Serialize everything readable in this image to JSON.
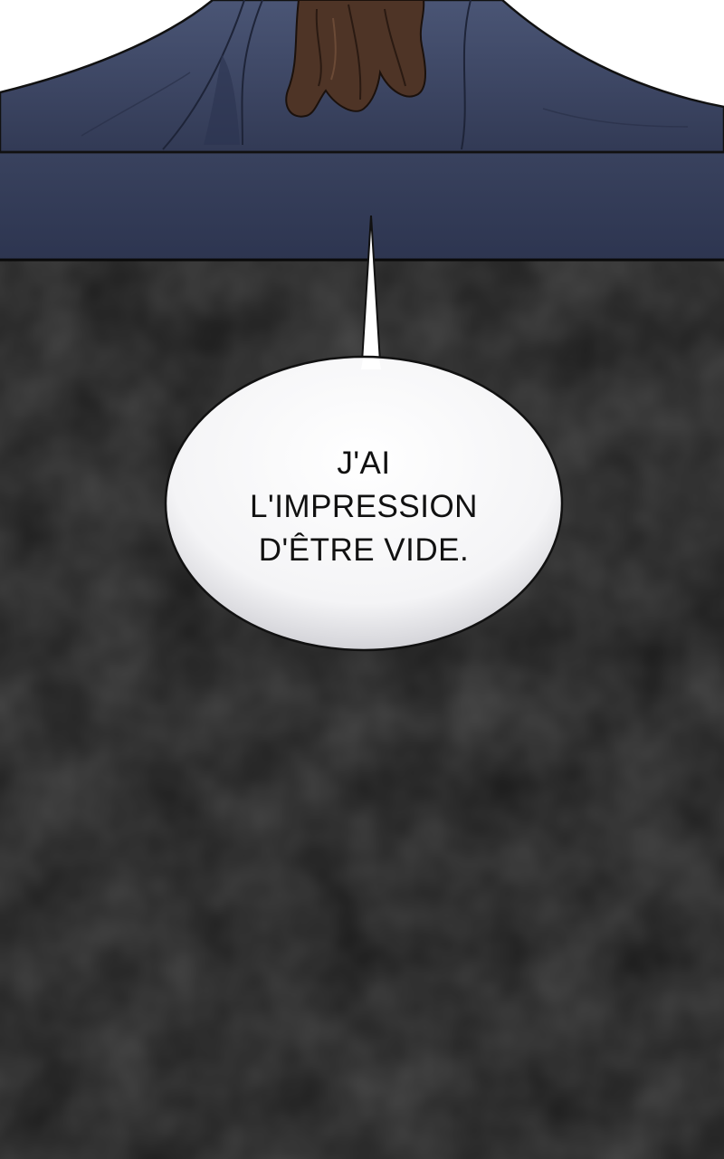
{
  "panel": {
    "speech_lines": [
      "J'AI",
      "L'IMPRESSION",
      "D'ÊTRE VIDE."
    ]
  },
  "colors": {
    "page_background": "#ffffff",
    "shadow_background": "#1a1a1a",
    "cloak_blue": "#3c4663",
    "cloak_shadow": "#2c3450",
    "hair_brown": "#4e3426",
    "bubble_fill": "#ffffff"
  }
}
